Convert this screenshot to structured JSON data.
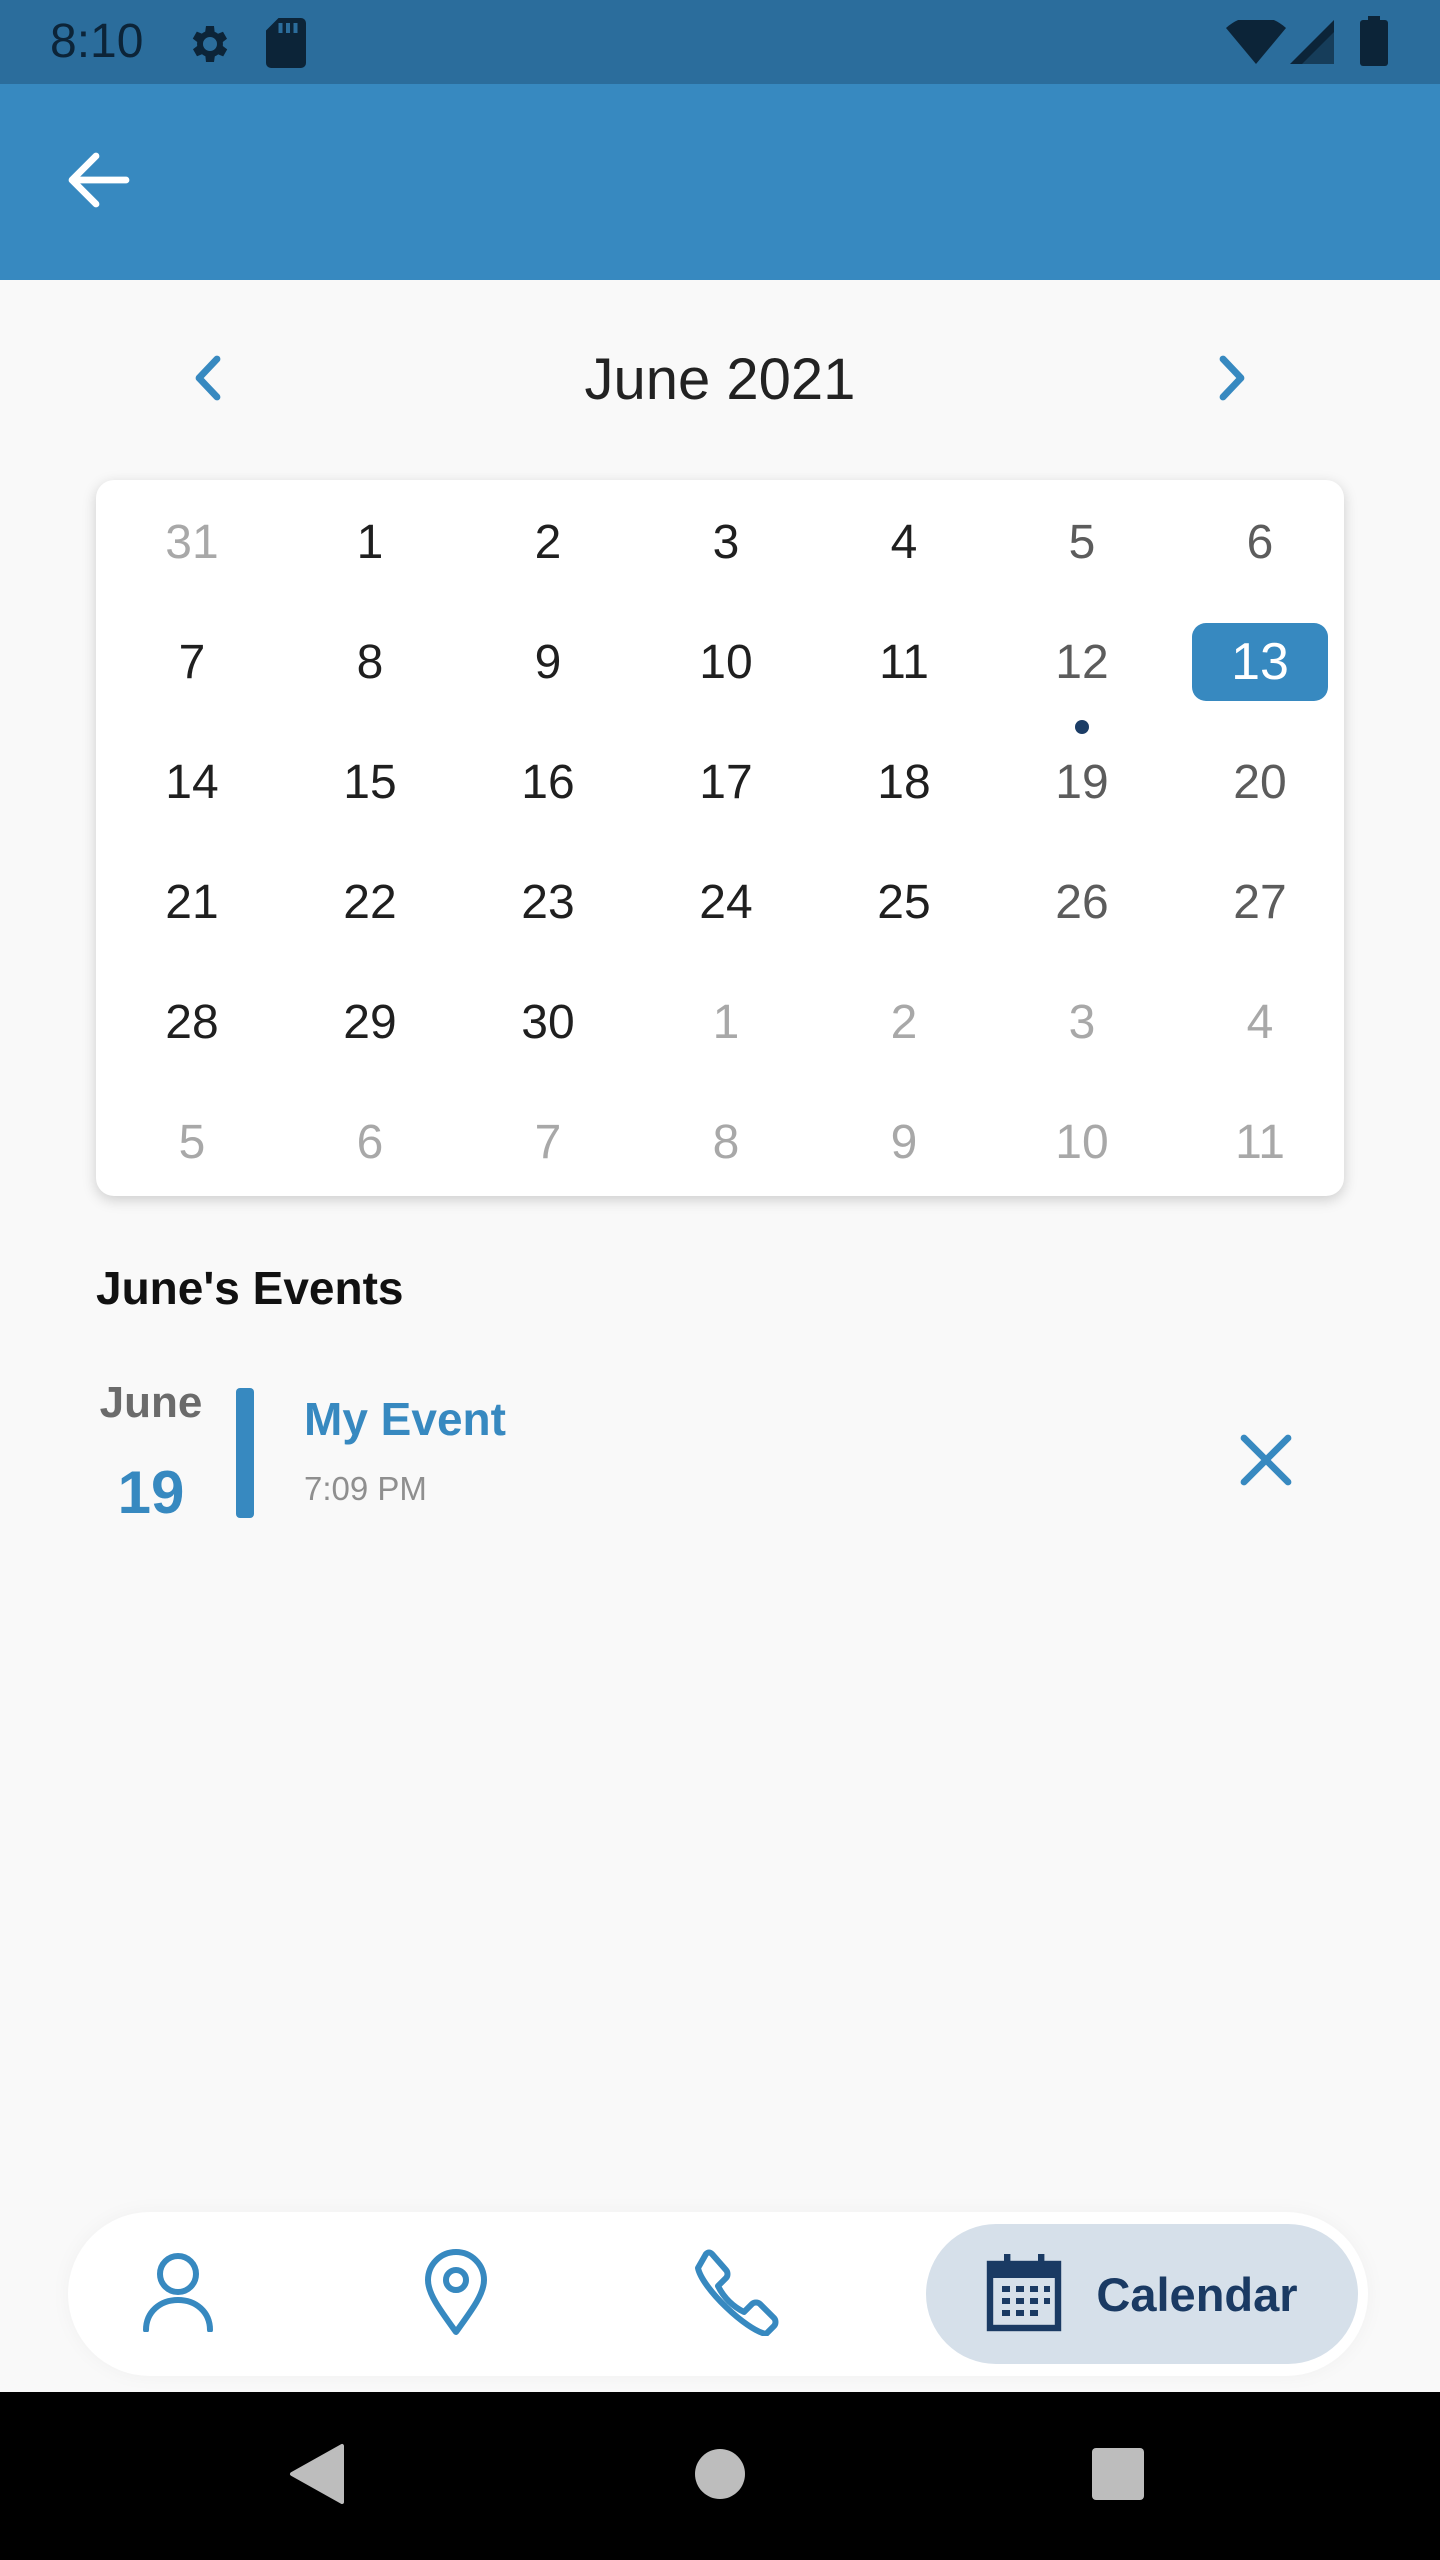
{
  "status_bar": {
    "time": "8:10",
    "icons": [
      "settings-icon",
      "sd-card-icon",
      "wifi-icon",
      "signal-icon",
      "battery-icon"
    ]
  },
  "app_bar": {
    "back_icon": "arrow-back-icon",
    "color": "#3789c0"
  },
  "calendar": {
    "month_title": "June 2021",
    "prev_icon": "chevron-left-icon",
    "next_icon": "chevron-right-icon",
    "selected_day": "13",
    "event_day": "19",
    "weeks": [
      [
        {
          "d": "31",
          "m": true
        },
        {
          "d": "1"
        },
        {
          "d": "2"
        },
        {
          "d": "3"
        },
        {
          "d": "4"
        },
        {
          "d": "5",
          "w": true
        },
        {
          "d": "6",
          "w": true
        }
      ],
      [
        {
          "d": "7"
        },
        {
          "d": "8"
        },
        {
          "d": "9"
        },
        {
          "d": "10"
        },
        {
          "d": "11"
        },
        {
          "d": "12",
          "w": true
        },
        {
          "d": "13",
          "w": true,
          "sel": true
        }
      ],
      [
        {
          "d": "14"
        },
        {
          "d": "15"
        },
        {
          "d": "16"
        },
        {
          "d": "17"
        },
        {
          "d": "18"
        },
        {
          "d": "19",
          "w": true,
          "ev": true
        },
        {
          "d": "20",
          "w": true
        }
      ],
      [
        {
          "d": "21"
        },
        {
          "d": "22"
        },
        {
          "d": "23"
        },
        {
          "d": "24"
        },
        {
          "d": "25"
        },
        {
          "d": "26",
          "w": true
        },
        {
          "d": "27",
          "w": true
        }
      ],
      [
        {
          "d": "28"
        },
        {
          "d": "29"
        },
        {
          "d": "30"
        },
        {
          "d": "1",
          "m": true
        },
        {
          "d": "2",
          "m": true
        },
        {
          "d": "3",
          "m": true
        },
        {
          "d": "4",
          "m": true
        }
      ],
      [
        {
          "d": "5",
          "m": true
        },
        {
          "d": "6",
          "m": true
        },
        {
          "d": "7",
          "m": true
        },
        {
          "d": "8",
          "m": true
        },
        {
          "d": "9",
          "m": true
        },
        {
          "d": "10",
          "m": true
        },
        {
          "d": "11",
          "m": true
        }
      ]
    ]
  },
  "events": {
    "heading": "June's Events",
    "items": [
      {
        "month": "June",
        "day": "19",
        "title": "My Event",
        "time": "7:09 PM",
        "delete_icon": "close-icon"
      }
    ]
  },
  "bottom_nav": {
    "items": [
      {
        "icon": "person-icon",
        "label": ""
      },
      {
        "icon": "location-pin-icon",
        "label": ""
      },
      {
        "icon": "phone-icon",
        "label": ""
      },
      {
        "icon": "calendar-icon",
        "label": "Calendar",
        "active": true
      }
    ]
  },
  "system_nav": {
    "icons": [
      "back-triangle-icon",
      "home-circle-icon",
      "recents-square-icon"
    ]
  }
}
